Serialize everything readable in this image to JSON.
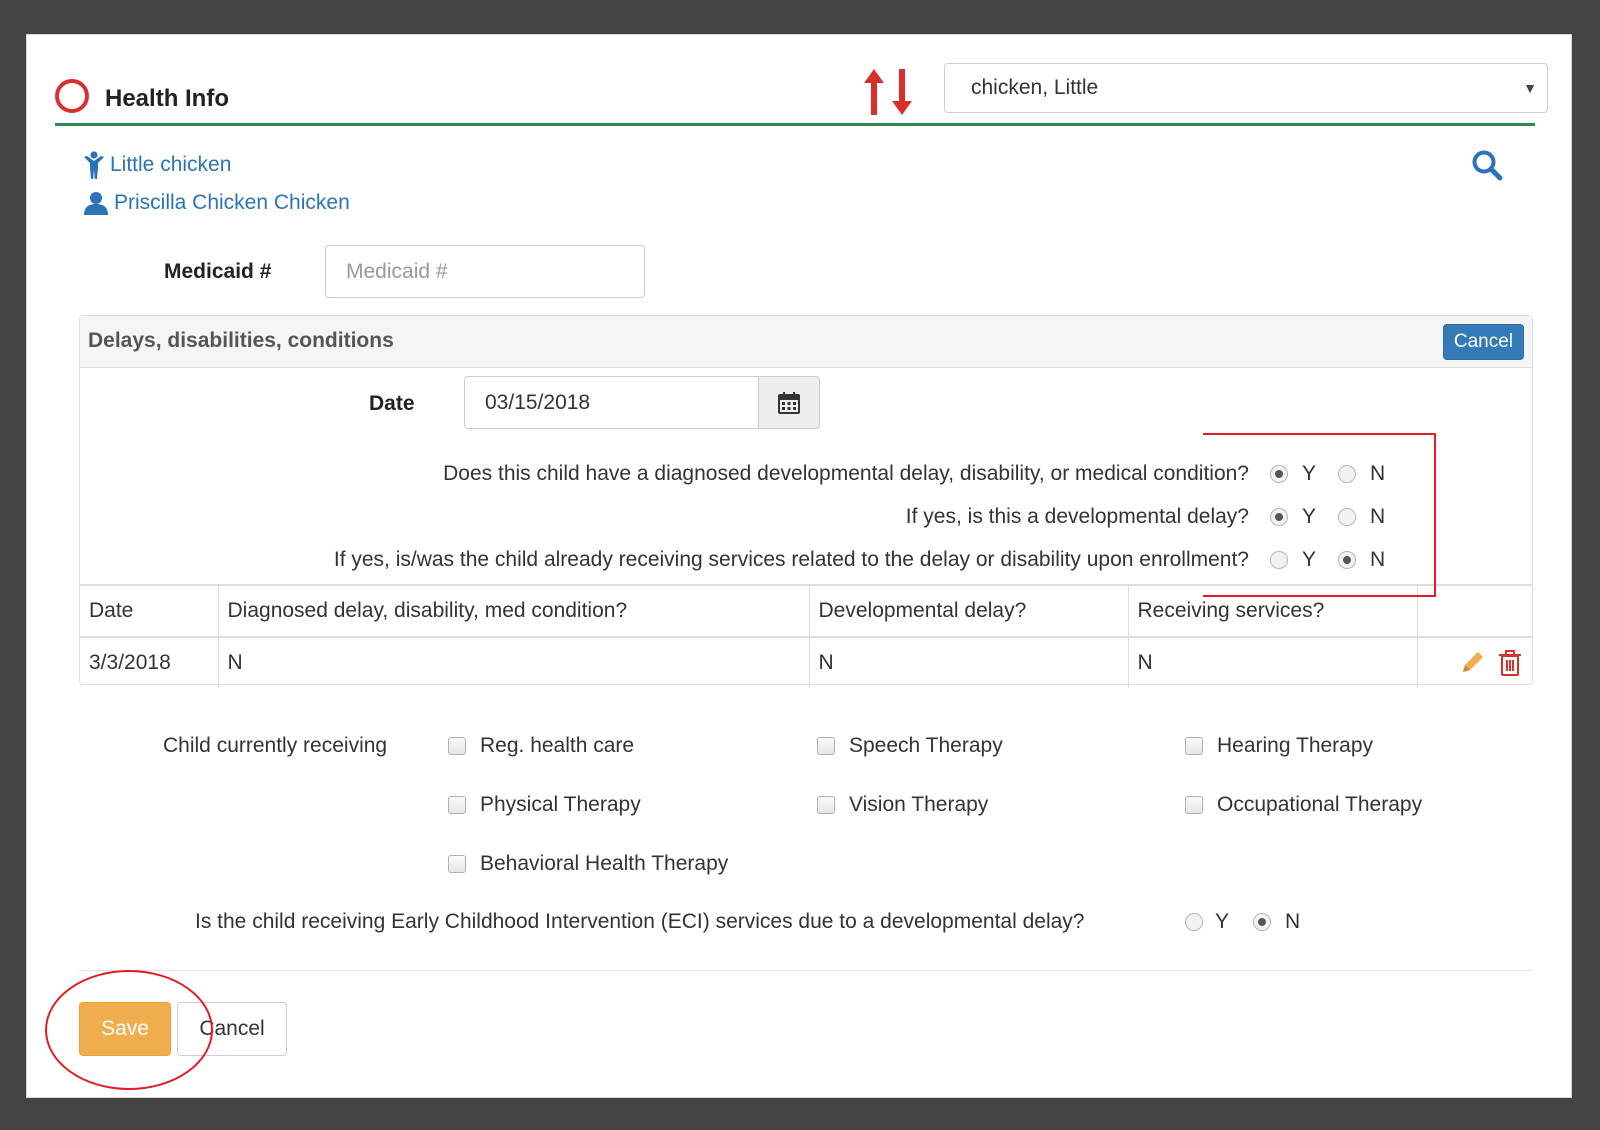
{
  "header": {
    "title": "Health Info",
    "child_select_value": "chicken, Little",
    "accent_color": "#d9302e",
    "rule_color": "#2f8a4b",
    "icons": [
      "circle-icon",
      "sort-arrows-icon",
      "chevron-down-icon"
    ]
  },
  "links": {
    "child_name": "Little chicken",
    "parent_name": "Priscilla Chicken Chicken",
    "icons": [
      "child-icon",
      "user-icon",
      "search-icon"
    ]
  },
  "medicaid": {
    "label": "Medicaid #",
    "placeholder": "Medicaid #",
    "value": ""
  },
  "panel": {
    "title": "Delays, disabilities, conditions",
    "cancel_label": "Cancel",
    "date_label": "Date",
    "date_value": "03/15/2018",
    "questions": [
      {
        "text": "Does this child have a diagnosed developmental delay, disability, or medical condition?",
        "yes": "Y",
        "no": "N",
        "selected": "Y"
      },
      {
        "text": "If yes, is this a developmental delay?",
        "yes": "Y",
        "no": "N",
        "selected": "Y"
      },
      {
        "text": "If yes, is/was the child already receiving services related to the delay or disability upon enrollment?",
        "yes": "Y",
        "no": "N",
        "selected": "N"
      }
    ],
    "table": {
      "headers": [
        "Date",
        "Diagnosed delay, disability, med condition?",
        "Developmental delay?",
        "Receiving services?"
      ],
      "rows": [
        [
          "3/3/2018",
          "N",
          "N",
          "N"
        ]
      ]
    }
  },
  "services": {
    "label": "Child currently receiving",
    "options": [
      {
        "label": "Reg. health care",
        "checked": false
      },
      {
        "label": "Speech Therapy",
        "checked": false
      },
      {
        "label": "Hearing Therapy",
        "checked": false
      },
      {
        "label": "Physical Therapy",
        "checked": false
      },
      {
        "label": "Vision Therapy",
        "checked": false
      },
      {
        "label": "Occupational Therapy",
        "checked": false
      },
      {
        "label": "Behavioral Health Therapy",
        "checked": false
      }
    ]
  },
  "eci": {
    "text": "Is the child receiving Early Childhood Intervention (ECI) services due to a developmental delay?",
    "yes": "Y",
    "no": "N",
    "selected": "N"
  },
  "footer": {
    "save_label": "Save",
    "cancel_label": "Cancel",
    "save_color": "#f0ad4e"
  },
  "annotation_color": "#e01c24"
}
